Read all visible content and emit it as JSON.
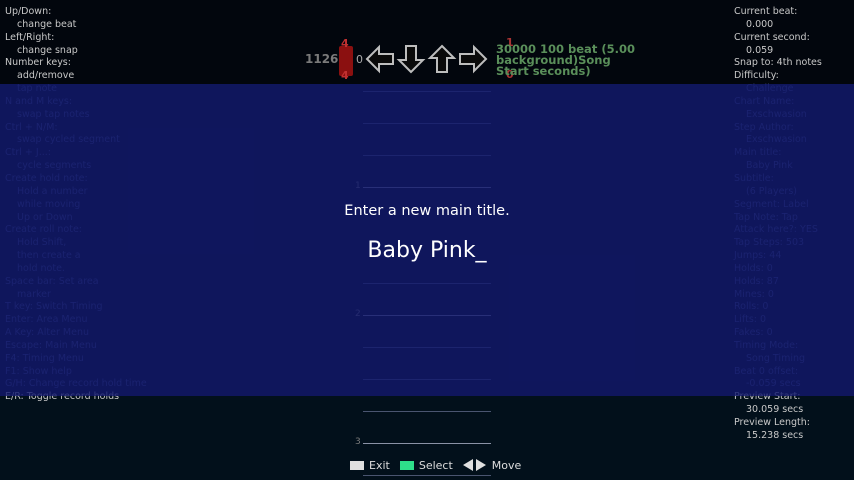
{
  "help_lines": [
    {
      "text": "Up/Down:",
      "indent": false
    },
    {
      "text": "change beat",
      "indent": true
    },
    {
      "text": "Left/Right:",
      "indent": false
    },
    {
      "text": "change snap",
      "indent": true
    },
    {
      "text": "Number keys:",
      "indent": false
    },
    {
      "text": "add/remove",
      "indent": true
    },
    {
      "text": "tap note",
      "indent": true
    },
    {
      "text": "N and M keys:",
      "indent": false
    },
    {
      "text": "swap tap notes",
      "indent": true
    },
    {
      "text": "Ctrl + N/M:",
      "indent": false
    },
    {
      "text": "swap cycled segment",
      "indent": true
    },
    {
      "text": "Ctrl + J...:",
      "indent": false
    },
    {
      "text": "cycle segments",
      "indent": true
    },
    {
      "text": "Create hold note:",
      "indent": false
    },
    {
      "text": "Hold a number",
      "indent": true
    },
    {
      "text": "while moving",
      "indent": true
    },
    {
      "text": "Up or Down",
      "indent": true
    },
    {
      "text": "Create roll note:",
      "indent": false
    },
    {
      "text": "Hold Shift,",
      "indent": true
    },
    {
      "text": "then create a",
      "indent": true
    },
    {
      "text": "hold note.",
      "indent": true
    },
    {
      "text": "Space bar: Set area",
      "indent": false
    },
    {
      "text": "marker",
      "indent": true
    },
    {
      "text": "T key: Switch Timing",
      "indent": false
    },
    {
      "text": "Enter: Area Menu",
      "indent": false
    },
    {
      "text": "A Key: Alter Menu",
      "indent": false
    },
    {
      "text": "Escape: Main Menu",
      "indent": false
    },
    {
      "text": "F4: Timing Menu",
      "indent": false
    },
    {
      "text": "F1: Show help",
      "indent": false
    },
    {
      "text": "G/H: Change record hold time",
      "indent": false
    },
    {
      "text": "E/R: Toggle record holds",
      "indent": false
    }
  ],
  "info_lines": [
    {
      "text": "Current beat:",
      "indent": false
    },
    {
      "text": "0.000",
      "indent": true
    },
    {
      "text": "Current second:",
      "indent": false
    },
    {
      "text": "0.059",
      "indent": true
    },
    {
      "text": "Snap to: 4th notes",
      "indent": false
    },
    {
      "text": "Difficulty:",
      "indent": false
    },
    {
      "text": "Challenge",
      "indent": true
    },
    {
      "text": "Chart Name:",
      "indent": false
    },
    {
      "text": "Exschwasion",
      "indent": true
    },
    {
      "text": "Step Author:",
      "indent": false
    },
    {
      "text": "Exschwasion",
      "indent": true
    },
    {
      "text": "Main title:",
      "indent": false
    },
    {
      "text": "Baby Pink",
      "indent": true
    },
    {
      "text": "Subtitle:",
      "indent": false
    },
    {
      "text": "(6 Players)",
      "indent": true
    },
    {
      "text": "Segment: Label",
      "indent": false
    },
    {
      "text": "Tap Note: Tap",
      "indent": false
    },
    {
      "text": "Attack here?: YES",
      "indent": false
    },
    {
      "text": "Tap Steps: 503",
      "indent": false
    },
    {
      "text": "Jumps: 44",
      "indent": false
    },
    {
      "text": "Holds: 0",
      "indent": false
    },
    {
      "text": "Holds: 87",
      "indent": false
    },
    {
      "text": "Mines: 0",
      "indent": false
    },
    {
      "text": "Rolls: 0",
      "indent": false
    },
    {
      "text": "Lifts: 0",
      "indent": false
    },
    {
      "text": "Fakes: 0",
      "indent": false
    },
    {
      "text": "Timing Mode:",
      "indent": false
    },
    {
      "text": "Song Timing",
      "indent": true
    },
    {
      "text": "Beat 0 offset:",
      "indent": false
    },
    {
      "text": "-0.059 secs",
      "indent": true
    },
    {
      "text": "Preview Start:",
      "indent": false
    },
    {
      "text": "30.059 secs",
      "indent": true
    },
    {
      "text": "Preview Length:",
      "indent": false
    },
    {
      "text": "15.238 secs",
      "indent": true
    }
  ],
  "header": {
    "beat_count": "1126",
    "zero_left": "0",
    "red_top": "4",
    "red_bottom": "4",
    "num_right_top": "1",
    "num_right_bottom": "0",
    "status_text": "30000 100 beat (5.00 background)Song Start seconds)"
  },
  "measures": [
    {
      "num": "1"
    },
    {
      "num": "2"
    },
    {
      "num": "3"
    }
  ],
  "dialog": {
    "prompt": "Enter a new main title.",
    "input_value": "Baby Pink_"
  },
  "footer": {
    "exit_label": "Exit",
    "select_label": "Select",
    "move_label": "Move"
  },
  "colors": {
    "overlay": "#121a6e",
    "select_key": "#2ee08a",
    "red_marker": "#8b1010"
  },
  "icons": [
    "arrow-left-icon",
    "arrow-down-icon",
    "arrow-up-icon",
    "arrow-right-icon"
  ]
}
